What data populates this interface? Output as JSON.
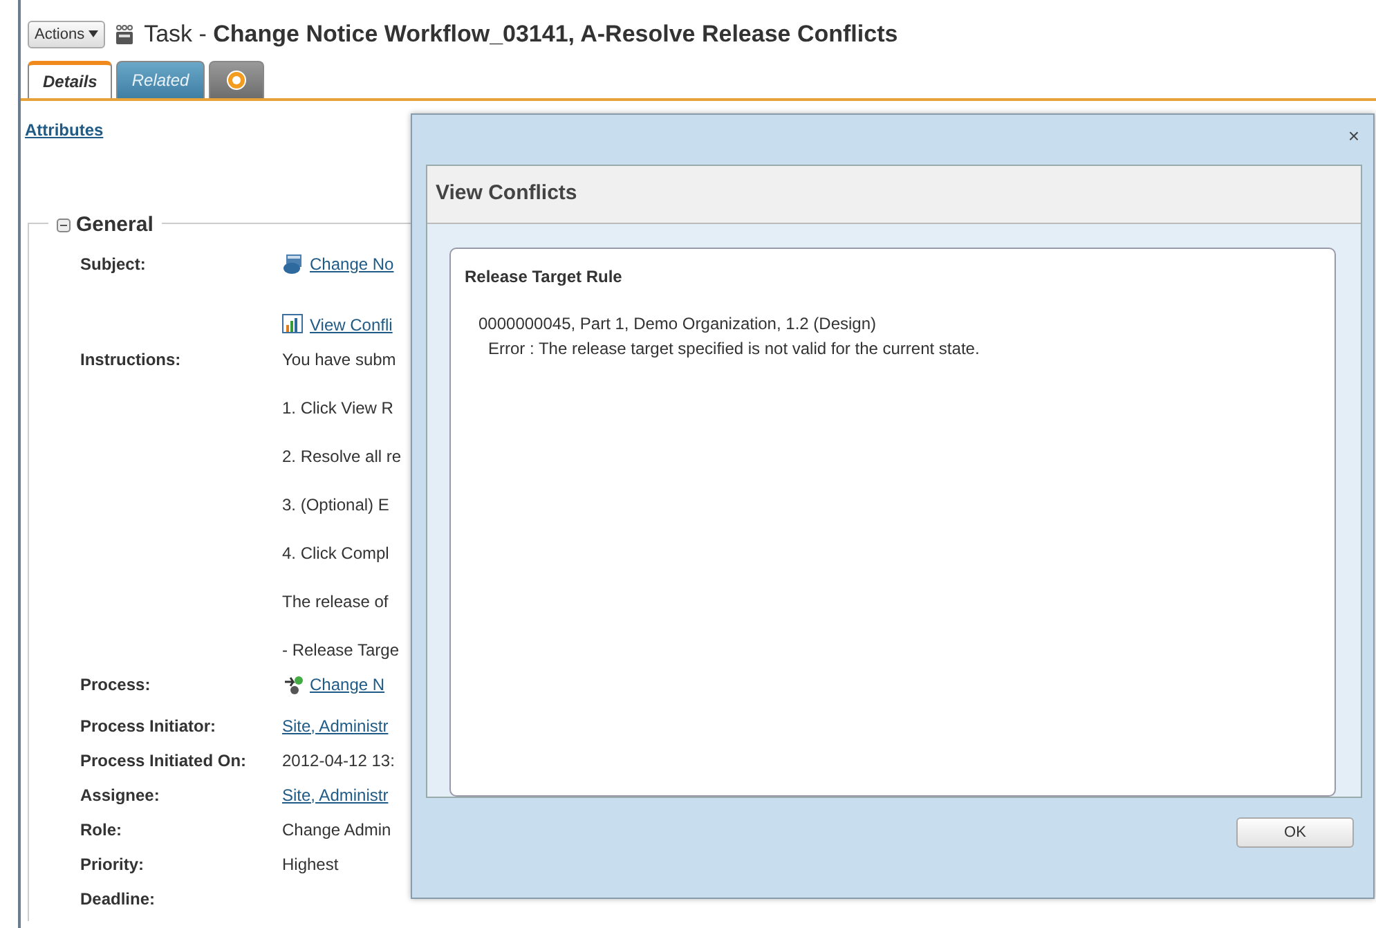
{
  "header": {
    "actions_button": "Actions",
    "title": "Task - **Change Notice Workflow_03141, A-Resolve Release Conflicts**"
  },
  "tabs": [
    {
      "kind": "text",
      "label": "Details",
      "selected": true
    },
    {
      "kind": "text",
      "label": "Related",
      "selected": false
    },
    {
      "kind": "add",
      "selected": false
    }
  ],
  "attributes_link": "Attributes",
  "general": {
    "title": "General",
    "expanded": true,
    "rows": [
      {
        "kind": "subject-link",
        "label": "Subject:",
        "value": "Change No"
      },
      {
        "kind": "report-link",
        "value": "View Confli"
      },
      {
        "kind": "paragraph",
        "label": "Instructions:",
        "value": "You have subm"
      },
      {
        "kind": "paragraph",
        "value": "1. Click View R"
      },
      {
        "kind": "paragraph",
        "value": "2. Resolve all re"
      },
      {
        "kind": "paragraph",
        "value": "3. (Optional) E"
      },
      {
        "kind": "paragraph",
        "value": "4. Click Compl"
      },
      {
        "kind": "paragraph",
        "value": "The release of"
      },
      {
        "kind": "text",
        "value": "- Release Targe"
      },
      {
        "kind": "process-link",
        "label": "Process:",
        "value": "Change N"
      },
      {
        "kind": "link",
        "label": "Process Initiator:",
        "value": "Site, Administr"
      },
      {
        "kind": "text",
        "label": "Process Initiated On:",
        "value": "2012-04-12 13:"
      },
      {
        "kind": "link",
        "label": "Assignee:",
        "value": "Site, Administr"
      },
      {
        "kind": "text",
        "label": "Role:",
        "value": "Change Admin"
      },
      {
        "kind": "text",
        "label": "Priority:",
        "value": "Highest"
      },
      {
        "kind": "text",
        "label": "Deadline:"
      }
    ]
  },
  "dialog": {
    "close": "×",
    "title": "View Conflicts",
    "section_title": "Release Target Rule",
    "lines": [
      "0000000045, Part 1, Demo Organization, 1.2 (Design)",
      "Error : The release target specified is not valid for the current state."
    ],
    "ok_button": "OK"
  }
}
